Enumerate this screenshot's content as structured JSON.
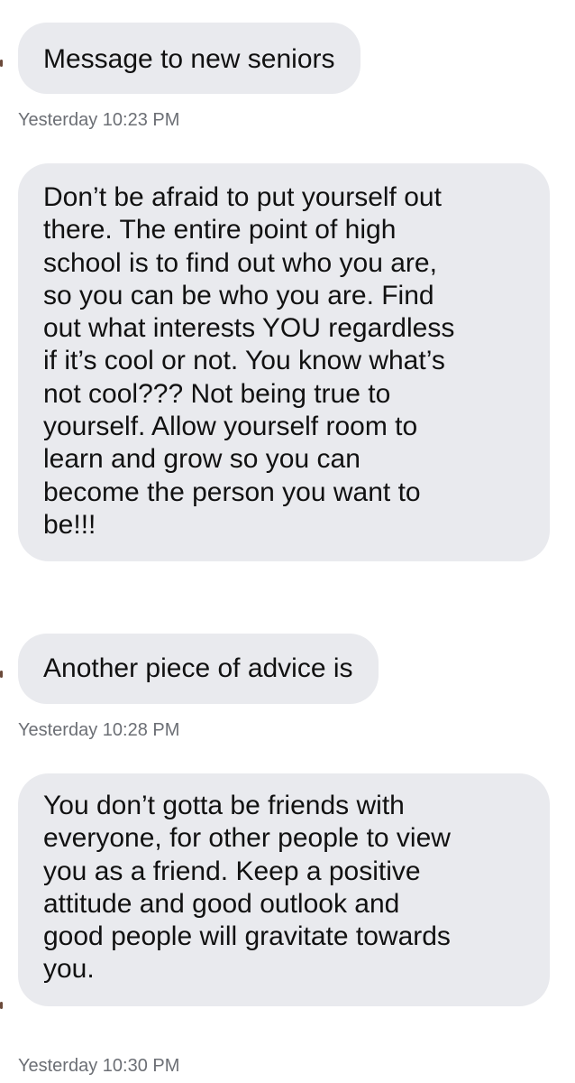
{
  "conversation": {
    "messages": [
      {
        "text": "Message to new seniors"
      },
      {
        "text": "Don’t be afraid to put yourself out\nthere. The entire point of high\nschool is to find out who you are,\nso you can be who you are.  Find\nout what interests YOU regardless\nif it’s cool or not. You know what’s\nnot cool??? Not being true to\nyourself. Allow yourself room to\nlearn and grow so you can\nbecome the person you want to\nbe!!!"
      },
      {
        "text": "Another piece of advice is"
      },
      {
        "text": "You don’t gotta be friends with\neveryone, for other people to view\nyou as a friend. Keep a positive\nattitude and good outlook and\ngood people will gravitate towards\nyou."
      }
    ],
    "timestamps": [
      "Yesterday 10:23 PM",
      "Yesterday 10:28 PM",
      "Yesterday 10:30 PM"
    ]
  },
  "colors": {
    "bubble_background": "#e9eaee",
    "message_text": "#111111",
    "timestamp_text": "#6c6f75",
    "page_background": "#ffffff"
  }
}
